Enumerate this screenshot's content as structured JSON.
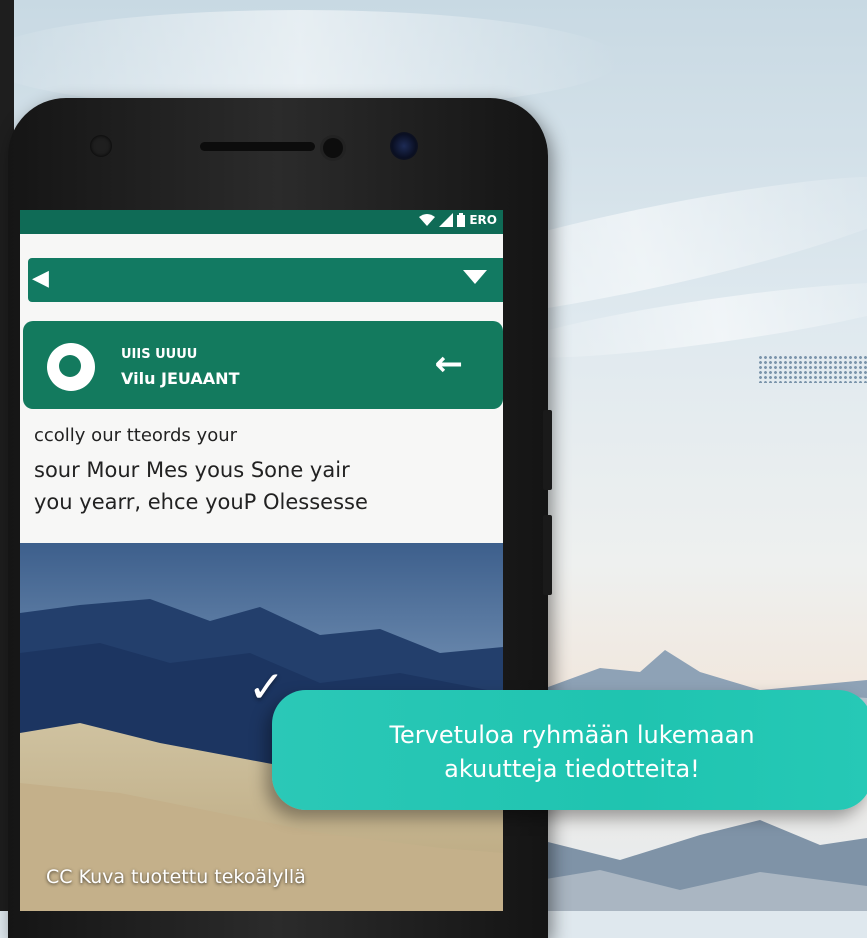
{
  "phone": {
    "status_bar": {
      "icons": [
        "wifi-icon",
        "signal-icon",
        "battery-icon"
      ],
      "time": "ERO"
    },
    "app_bar": {
      "back_icon": "back-arrow-icon",
      "menu_icon": "dropdown-icon",
      "color": "#127a62"
    },
    "chat_card": {
      "line1": "UIIS UUUU",
      "line2": "Vilu JEUAANT",
      "arrow_icon": "back-arrow-icon",
      "color": "#137a5e"
    },
    "message": {
      "line1": "ccolly our tteords your",
      "line2": "sour Mour Mes yous Sone yair",
      "line3": "you yearr, ehce youP Olessesse"
    }
  },
  "overlay": {
    "bubble_text_line1": "Tervetuloa ryhmään lukemaan",
    "bubble_text_line2": "akuutteja tiedotteita!",
    "bubble_color": "#22c6b2",
    "checkmark": "✓",
    "credit": "CC Kuva tuotettu tekoälyllä"
  }
}
